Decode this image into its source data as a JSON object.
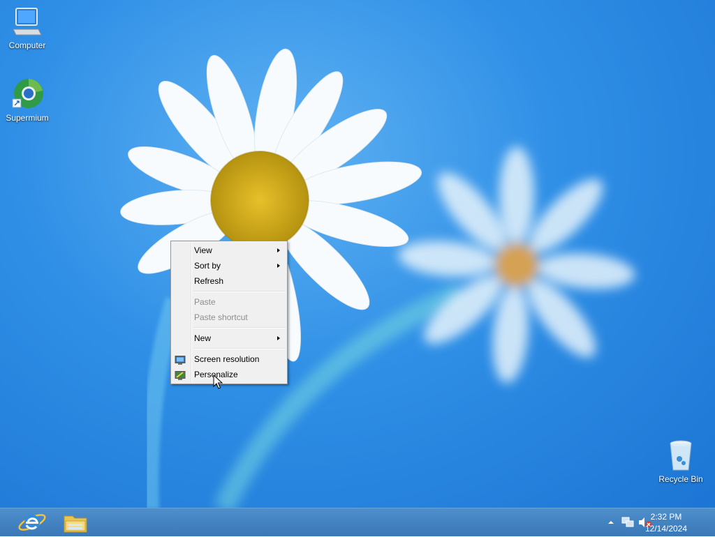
{
  "desktop": {
    "icons": [
      {
        "label": "Computer"
      },
      {
        "label": "Supermium"
      },
      {
        "label": "Recycle Bin"
      }
    ]
  },
  "context_menu": {
    "items": [
      {
        "label": "View",
        "has_submenu": true,
        "enabled": true
      },
      {
        "label": "Sort by",
        "has_submenu": true,
        "enabled": true
      },
      {
        "label": "Refresh",
        "has_submenu": false,
        "enabled": true
      },
      {
        "label": "Paste",
        "has_submenu": false,
        "enabled": false
      },
      {
        "label": "Paste shortcut",
        "has_submenu": false,
        "enabled": false
      },
      {
        "label": "New",
        "has_submenu": true,
        "enabled": true
      },
      {
        "label": "Screen resolution",
        "icon": "monitor-icon",
        "enabled": true
      },
      {
        "label": "Personalize",
        "icon": "personalize-icon",
        "enabled": true
      }
    ]
  },
  "taskbar": {
    "pinned": [
      {
        "icon": "internet-explorer-icon"
      },
      {
        "icon": "file-explorer-icon"
      }
    ],
    "tray": {
      "icons": [
        "show-hidden-icons-arrow",
        "network-icon",
        "volume-muted-icon"
      ],
      "time": "2:32 PM",
      "date": "12/14/2024"
    }
  },
  "colors": {
    "desktop_blue": "#2f8fe6",
    "taskbar_blue": "#3a77b8",
    "menu_background": "#f0f0f0"
  }
}
